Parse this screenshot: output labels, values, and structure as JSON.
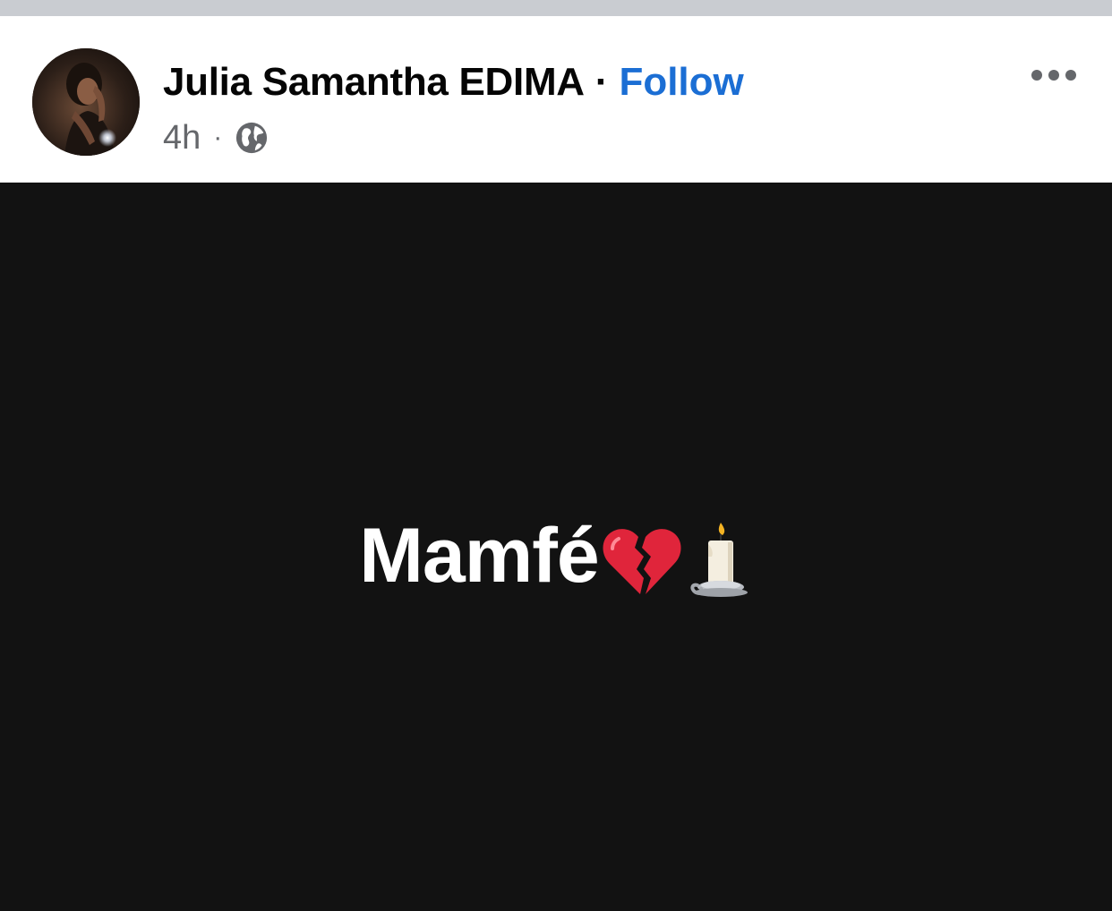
{
  "post": {
    "author": {
      "name": "Julia Samantha EDIMA",
      "separator": "·",
      "follow_label": "Follow",
      "avatar": "profile-photo"
    },
    "meta": {
      "time": "4h",
      "separator": "·",
      "audience_icon": "globe-icon"
    },
    "menu_icon": "more-options-icon",
    "body": {
      "text": "Mamfé",
      "emojis": [
        "broken-heart-icon",
        "candle-icon"
      ],
      "background": "#121212",
      "text_color": "#ffffff"
    }
  },
  "colors": {
    "follow": "#1b6ed4",
    "secondary_text": "#65676b",
    "primary_text": "#050505",
    "top_strip": "#c9ccd1"
  }
}
